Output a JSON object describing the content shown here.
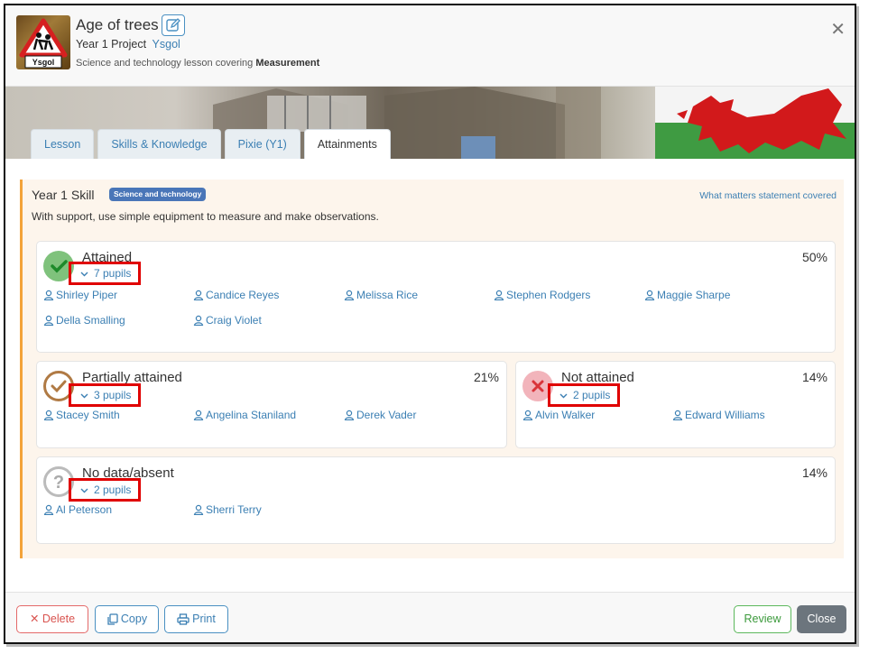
{
  "header": {
    "title": "Age of trees",
    "project_label": "Year 1 Project",
    "project_link": "Ysgol",
    "desc_prefix": "Science and technology lesson covering",
    "desc_topic": "Measurement",
    "thumb_text": "Ysgol"
  },
  "tabs": [
    {
      "label": "Lesson"
    },
    {
      "label": "Skills & Knowledge"
    },
    {
      "label": "Pixie (Y1)"
    },
    {
      "label": "Attainments"
    }
  ],
  "skill": {
    "title": "Year 1 Skill",
    "badge": "Science and technology",
    "what_matters": "What matters statement covered",
    "description": "With support, use simple equipment to measure and make observations."
  },
  "groups": {
    "attained": {
      "title": "Attained",
      "percent": "50%",
      "pupils_label": "7 pupils",
      "pupils": [
        "Shirley Piper",
        "Candice Reyes",
        "Melissa Rice",
        "Stephen Rodgers",
        "Maggie Sharpe",
        "Della Smalling",
        "Craig Violet"
      ]
    },
    "partial": {
      "title": "Partially attained",
      "percent": "21%",
      "pupils_label": "3 pupils",
      "pupils": [
        "Stacey Smith",
        "Angelina Staniland",
        "Derek Vader"
      ]
    },
    "not_attained": {
      "title": "Not attained",
      "percent": "14%",
      "pupils_label": "2 pupils",
      "pupils": [
        "Alvin Walker",
        "Edward Williams"
      ]
    },
    "no_data": {
      "title": "No data/absent",
      "percent": "14%",
      "pupils_label": "2 pupils",
      "pupils": [
        "Al Peterson",
        "Sherri Terry"
      ]
    }
  },
  "footer": {
    "delete": "Delete",
    "copy": "Copy",
    "print": "Print",
    "review": "Review",
    "close": "Close"
  },
  "colors": {
    "accent": "#3b7fb3",
    "skill_border": "#f3a33a",
    "highlight_box": "#e00000"
  },
  "icons": [
    "edit-icon",
    "close-icon",
    "check-icon",
    "cross-icon",
    "question-icon",
    "user-icon",
    "chevron-down-icon",
    "copy-icon",
    "print-icon",
    "welsh-dragon-icon"
  ]
}
